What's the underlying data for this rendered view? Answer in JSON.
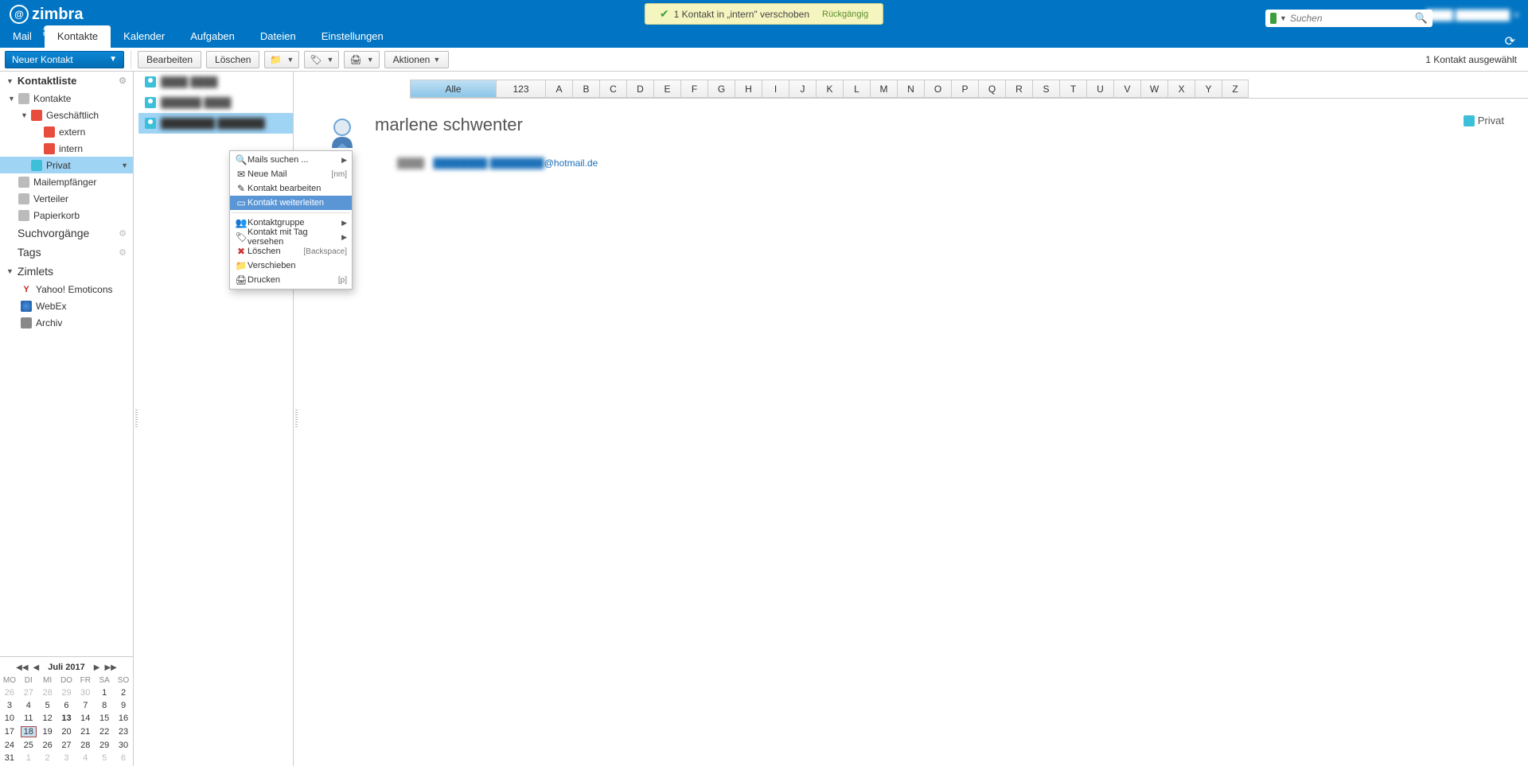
{
  "logo": {
    "name": "zimbra",
    "sub": "A SYNACOR PRODUCT"
  },
  "toast": {
    "text": "1 Kontakt in „intern\" verschoben",
    "undo": "Rückgängig"
  },
  "search": {
    "placeholder": "Suchen"
  },
  "user": {
    "name": "████ ████████"
  },
  "tabs": [
    {
      "label": "Mail",
      "active": false
    },
    {
      "label": "Kontakte",
      "active": true
    },
    {
      "label": "Kalender",
      "active": false
    },
    {
      "label": "Aufgaben",
      "active": false
    },
    {
      "label": "Dateien",
      "active": false
    },
    {
      "label": "Einstellungen",
      "active": false
    }
  ],
  "toolbar": {
    "newContact": "Neuer Kontakt",
    "edit": "Bearbeiten",
    "delete": "Löschen",
    "actions": "Aktionen",
    "selection": "1 Kontakt ausgewählt"
  },
  "sidebar": {
    "contactList": "Kontaktliste",
    "tree": {
      "contacts": "Kontakte",
      "business": "Geschäftlich",
      "extern": "extern",
      "intern": "intern",
      "private": "Privat",
      "mailrecipients": "Mailempfänger",
      "distribution": "Verteiler",
      "trash": "Papierkorb"
    },
    "searches": "Suchvorgänge",
    "tags": "Tags",
    "zimlets": "Zimlets",
    "zimletItems": {
      "yahoo": "Yahoo! Emoticons",
      "webex": "WebEx",
      "archive": "Archiv"
    }
  },
  "minical": {
    "title": "Juli 2017",
    "dow": [
      "MO",
      "DI",
      "MI",
      "DO",
      "FR",
      "SA",
      "SO"
    ],
    "weeks": [
      [
        "26",
        "27",
        "28",
        "29",
        "30",
        "1",
        "2"
      ],
      [
        "3",
        "4",
        "5",
        "6",
        "7",
        "8",
        "9"
      ],
      [
        "10",
        "11",
        "12",
        "13",
        "14",
        "15",
        "16"
      ],
      [
        "17",
        "18",
        "19",
        "20",
        "21",
        "22",
        "23"
      ],
      [
        "24",
        "25",
        "26",
        "27",
        "28",
        "29",
        "30"
      ],
      [
        "31",
        "1",
        "2",
        "3",
        "4",
        "5",
        "6"
      ]
    ],
    "today": "18",
    "bold": "13"
  },
  "contactList": [
    {
      "name": "████ ████",
      "selected": false
    },
    {
      "name": "██████ ████",
      "selected": false
    },
    {
      "name": "████████ ███████",
      "selected": true
    }
  ],
  "alpha": {
    "all": "Alle",
    "num": "123",
    "letters": [
      "A",
      "B",
      "C",
      "D",
      "E",
      "F",
      "G",
      "H",
      "I",
      "J",
      "K",
      "L",
      "M",
      "N",
      "O",
      "P",
      "Q",
      "R",
      "S",
      "T",
      "U",
      "V",
      "W",
      "X",
      "Y",
      "Z"
    ]
  },
  "contact": {
    "name": "marlene schwenter",
    "folder": "Privat",
    "emailLabel": "████",
    "emailPrefix": "████████ ████████",
    "emailSuffix": "@hotmail.de"
  },
  "ctx": {
    "searchMails": "Mails suchen ...",
    "newMail": "Neue Mail",
    "newMailSc": "[nm]",
    "editContact": "Kontakt bearbeiten",
    "forwardContact": "Kontakt weiterleiten",
    "contactGroup": "Kontaktgruppe",
    "tagContact": "Kontakt mit Tag versehen",
    "delete": "Löschen",
    "deleteSc": "[Backspace]",
    "move": "Verschieben",
    "print": "Drucken",
    "printSc": "[p]"
  }
}
